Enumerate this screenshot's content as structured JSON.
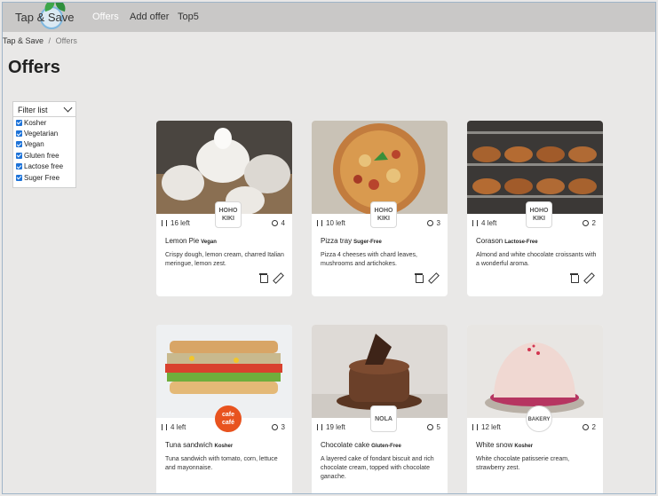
{
  "app": {
    "brand": "Tap & Save"
  },
  "nav": [
    {
      "label": "Offers",
      "active": true
    },
    {
      "label": "Add offer",
      "active": false
    },
    {
      "label": "Top5",
      "active": false
    }
  ],
  "breadcrumb": {
    "root": "Tap & Save",
    "separator": "/",
    "current": "Offers"
  },
  "page_title": "Offers",
  "filter": {
    "title": "Filter list",
    "items": [
      {
        "label": "Kosher",
        "checked": true
      },
      {
        "label": "Vegetarian",
        "checked": true
      },
      {
        "label": "Vegan",
        "checked": true
      },
      {
        "label": "Gluten free",
        "checked": true
      },
      {
        "label": "Lactose free",
        "checked": true
      },
      {
        "label": "Suger Free",
        "checked": true
      }
    ]
  },
  "cards": [
    {
      "name": "Lemon Pie",
      "tag": "Vegan",
      "left": "16 left",
      "likes": "4",
      "logo": "HOHO KIKI",
      "desc": "Crispy dough, lemon cream, charred Italian meringue, lemon zest."
    },
    {
      "name": "Pizza tray",
      "tag": "Suger-Free",
      "left": "10 left",
      "likes": "3",
      "logo": "HOHO KIKI",
      "desc": "Pizza 4 cheeses with chard leaves, mushrooms and artichokes."
    },
    {
      "name": "Corason",
      "tag": "Lactose-Free",
      "left": "4 left",
      "likes": "2",
      "logo": "HOHO KIKI",
      "desc": "Almond and white chocolate croissants with a wonderful aroma."
    },
    {
      "name": "Tuna sandwich",
      "tag": "Kosher",
      "left": "4 left",
      "likes": "3",
      "logo": "cafe café",
      "desc": "Tuna sandwich with tomato, corn, lettuce and mayonnaise."
    },
    {
      "name": "Chocolate cake",
      "tag": "Gluten-Free",
      "left": "19 left",
      "likes": "5",
      "logo": "NOLA",
      "desc": "A layered cake of fondant biscuit and rich chocolate cream, topped with chocolate ganache."
    },
    {
      "name": "White snow",
      "tag": "Kosher",
      "left": "12 left",
      "likes": "2",
      "logo": "BAKERY",
      "desc": "White chocolate patisserie cream, strawberry zest."
    }
  ],
  "colors": {
    "navbar": "#c9c8c7",
    "page_bg": "#e9e8e7",
    "checkbox": "#1e73d8"
  }
}
